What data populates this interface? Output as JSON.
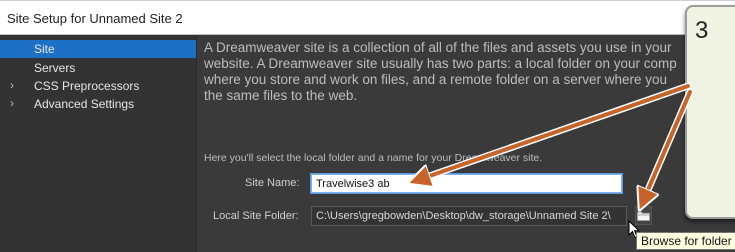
{
  "dialog": {
    "title": "Site Setup for Unnamed Site 2"
  },
  "sidebar": {
    "items": [
      {
        "label": "Site",
        "selected": true,
        "expandable": false
      },
      {
        "label": "Servers",
        "selected": false,
        "expandable": false
      },
      {
        "label": "CSS Preprocessors",
        "selected": false,
        "expandable": true
      },
      {
        "label": "Advanced Settings",
        "selected": false,
        "expandable": true
      }
    ]
  },
  "main": {
    "intro_lines": [
      "A Dreamweaver site is a collection of all of the files and assets you use in your",
      "website. A Dreamweaver site usually has two parts: a local folder on your comp",
      "where you store and work on files, and a remote folder on a server where you",
      "the same files to the web."
    ],
    "local_intro": "Here you'll select the local folder and a name for your Dreamweaver site.",
    "site_name_label": "Site Name:",
    "site_name_value": "Travelwise3 ab",
    "local_folder_label": "Local Site Folder:",
    "local_folder_value": "C:\\Users\\gregbowden\\Desktop\\dw_storage\\Unnamed Site 2\\"
  },
  "tooltip": {
    "text": "Browse for folder"
  },
  "callout": {
    "step": "3"
  },
  "icons": {
    "browse": "folder-icon",
    "cursor": "cursor-arrow-icon",
    "expand": "chevron-right-icon"
  },
  "colors": {
    "selection": "#1e6fc6",
    "panel": "#3a3a3a",
    "sidebar": "#333333",
    "annotation_arrow": "#c8642a",
    "callout_bg": "#eef3e2"
  }
}
